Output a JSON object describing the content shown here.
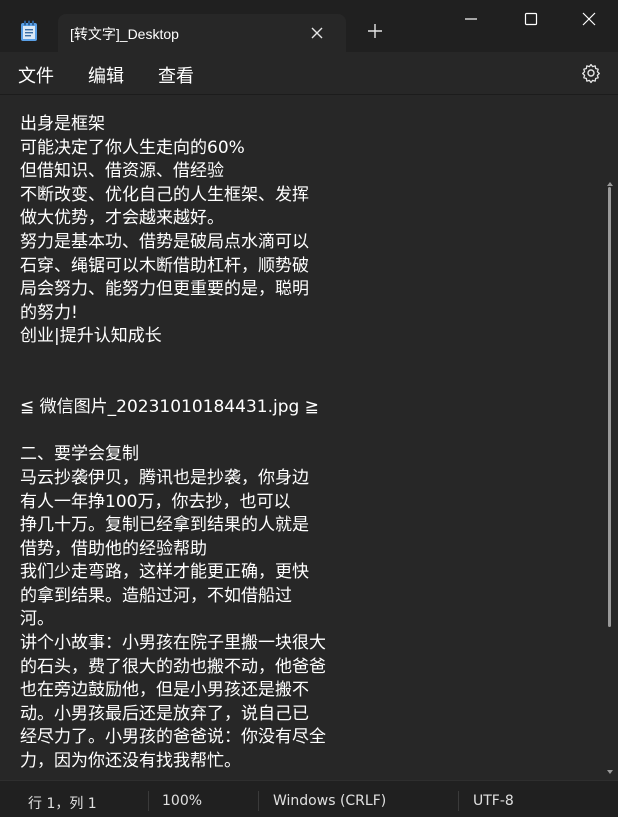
{
  "window": {
    "tab_title": "[转文字]_Desktop",
    "icons": {
      "app": "notepad-icon",
      "close_tab": "close-icon",
      "new_tab": "plus-icon",
      "minimize": "minimize-icon",
      "maximize": "maximize-icon",
      "close_window": "close-icon"
    }
  },
  "menu": {
    "file": "文件",
    "edit": "编辑",
    "view": "查看",
    "settings_icon": "gear-icon"
  },
  "document": {
    "lines": [
      "出身是框架",
      "可能决定了你人生走向的60%",
      "但借知识、借资源、借经验",
      "不断改变、优化自己的人生框架、发挥",
      "做大优势，才会越来越好。",
      "努力是基本功、借势是破局点水滴可以",
      "石穿、绳锯可以木断借助杠杆，顺势破",
      "局会努力、能努力但更重要的是，聪明",
      "的努力!",
      "创业|提升认知成长",
      "",
      "",
      "≦ 微信图片_20231010184431.jpg ≧",
      "",
      "二、要学会复制",
      "马云抄袭伊贝，腾讯也是抄袭，你身边",
      "有人一年挣100万，你去抄，也可以",
      "挣几十万。复制已经拿到结果的人就是",
      "借势，借助他的经验帮助",
      "我们少走弯路，这样才能更正确，更快",
      "的拿到结果。造船过河，不如借船过",
      "河。",
      "讲个小故事：小男孩在院子里搬一块很大",
      "的石头，费了很大的劲也搬不动，他爸爸",
      "也在旁边鼓励他，但是小男孩还是搬不",
      "动。小男孩最后还是放弃了，说自己已",
      "经尽力了。小男孩的爸爸说：你没有尽全",
      "力，因为你还没有找我帮忙。"
    ]
  },
  "status": {
    "position": "行 1，列 1",
    "zoom": "100%",
    "line_ending": "Windows (CRLF)",
    "encoding": "UTF-8"
  },
  "colors": {
    "titlebar": "#202020",
    "editor_bg": "#272727",
    "text": "#ffffff"
  }
}
